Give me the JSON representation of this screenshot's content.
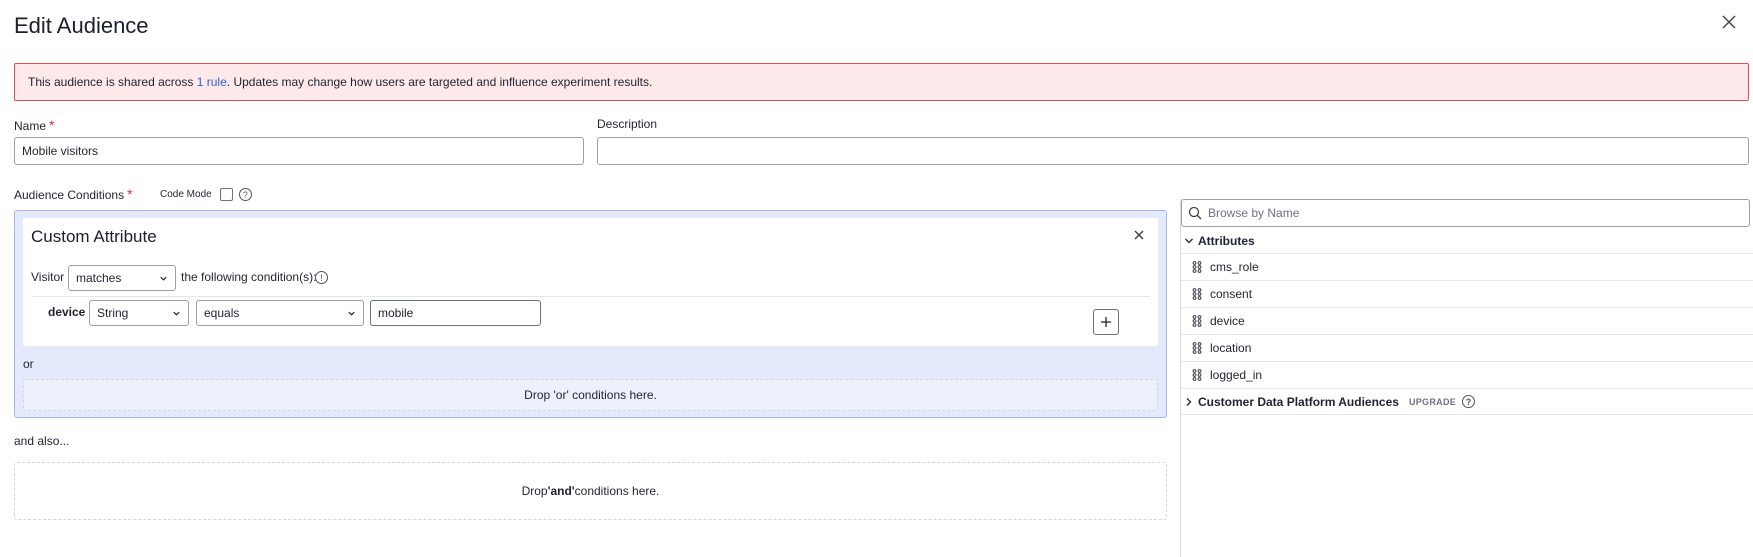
{
  "header": {
    "title": "Edit Audience",
    "close_icon": "close-icon"
  },
  "banner": {
    "text_before": "This audience is shared across ",
    "link": "1 rule",
    "text_after": ". Updates may change how users are targeted and influence experiment results.",
    "border_color": "#e14b5a",
    "background": "#fde8ea"
  },
  "form": {
    "name_label": "Name",
    "required_mark": "*",
    "name_value": "Mobile visitors",
    "description_label": "Description",
    "description_value": ""
  },
  "conditions": {
    "label": "Audience Conditions",
    "code_mode_label": "Code Mode",
    "help_glyph": "?",
    "card_title": "Custom Attribute",
    "visitor_label": "Visitor",
    "match_select": "matches",
    "following_text": "the following condition(s):",
    "info_glyph": "!",
    "row": {
      "attribute": "device",
      "type_select": "String",
      "operator_select": "equals",
      "value": "mobile"
    },
    "or_label": "or",
    "drop_or": "Drop 'or' conditions here.",
    "and_also": "and also...",
    "drop_and_before": "Drop ",
    "drop_and_bold": "'and'",
    "drop_and_after": " conditions here.",
    "accent_color": "#a6b7f0"
  },
  "browser": {
    "search_placeholder": "Browse by Name",
    "attributes_header": "Attributes",
    "attributes": [
      "cms_role",
      "consent",
      "device",
      "location",
      "logged_in"
    ],
    "cdp_header": "Customer Data Platform Audiences",
    "cdp_badge": "UPGRADE"
  }
}
